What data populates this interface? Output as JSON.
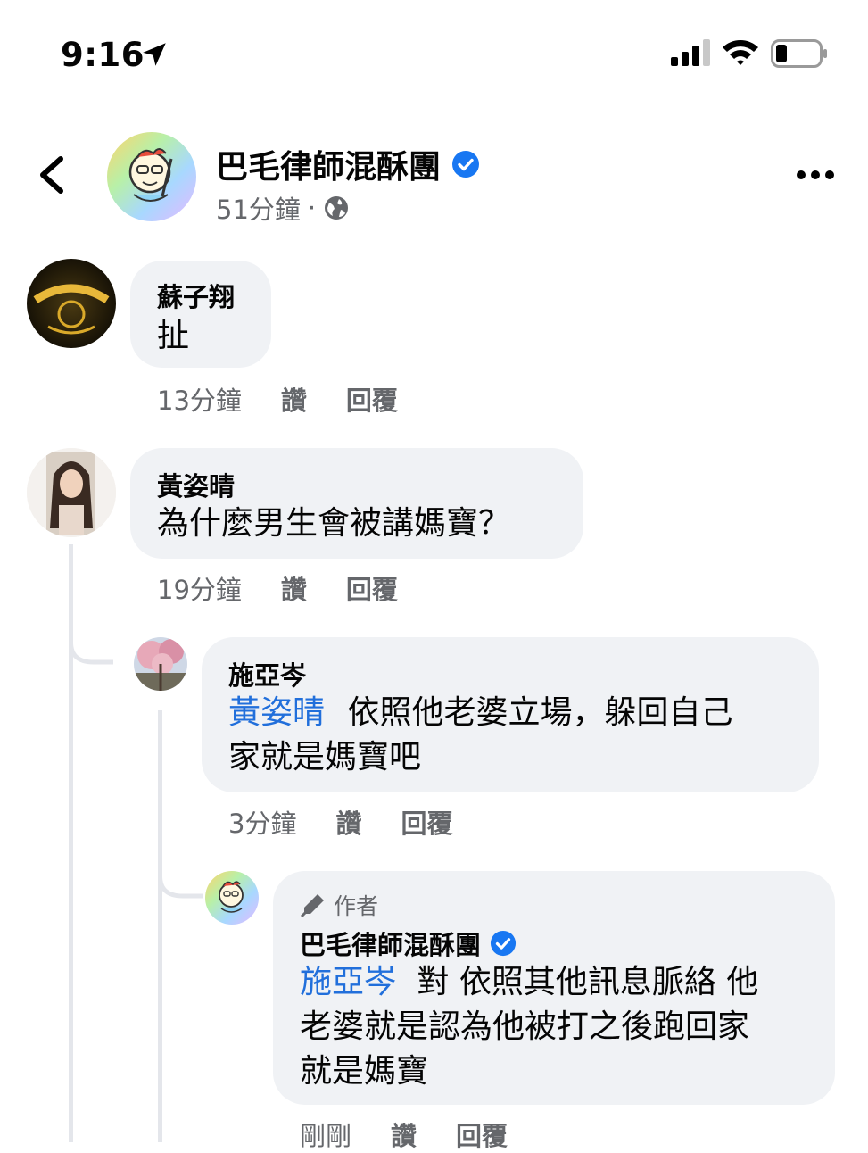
{
  "status_bar": {
    "time": "9:16"
  },
  "header": {
    "page_name": "巴毛律師混酥團",
    "time_ago": "51分鐘",
    "separator": "·"
  },
  "comments": [
    {
      "author": "蘇子翔",
      "text": "扯",
      "time": "13分鐘",
      "like": "讚",
      "reply": "回覆"
    },
    {
      "author": "黃姿晴",
      "text": "為什麼男生會被講媽寶？",
      "time": "19分鐘",
      "like": "讚",
      "reply": "回覆",
      "replies": [
        {
          "author": "施亞岑",
          "mention": "黃姿晴",
          "text_line1": "依照他老婆立場，躲回自己",
          "text_line2": "家就是媽寶吧",
          "time": "3分鐘",
          "like": "讚",
          "reply": "回覆",
          "replies": [
            {
              "author_tag": "作者",
              "author": "巴毛律師混酥團",
              "mention": "施亞岑",
              "text_line1": "對 依照其他訊息脈絡 他",
              "text_line2": "老婆就是認為他被打之後跑回家",
              "text_line3": "就是媽寶",
              "time": "剛剛",
              "like": "讚",
              "reply": "回覆"
            }
          ]
        }
      ]
    }
  ],
  "colors": {
    "mention": "#216fdb",
    "bubble": "#f0f2f5",
    "verified": "#1877f2",
    "meta": "#65676b"
  }
}
